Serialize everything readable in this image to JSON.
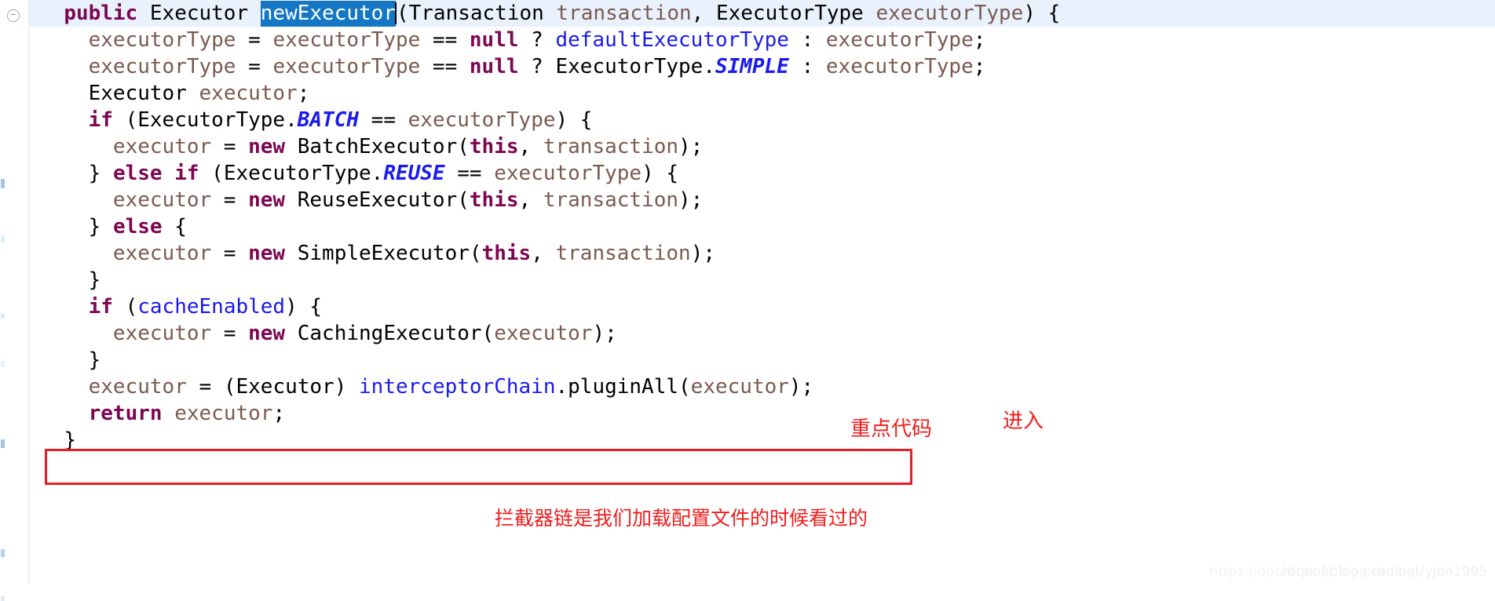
{
  "editor": {
    "language": "java",
    "colors": {
      "keyword": "#7d0552",
      "variable": "#7a5a52",
      "field": "#1a1aee",
      "enum_constant": "#1a1aee",
      "plain": "#000000",
      "selection_background": "#1577c4",
      "selection_foreground": "#ffffff",
      "current_line_background": "#e9f1fd",
      "annotation_red": "#ee1c22"
    },
    "gutter": {
      "fold_icon": "fold-collapse-icon"
    },
    "selection": {
      "text": "newExecutor",
      "line": 1
    },
    "lines": [
      {
        "indent": "  ",
        "highlighted": true,
        "tokens": [
          {
            "t": "public",
            "c": "kw"
          },
          {
            "t": " ",
            "c": "plain"
          },
          {
            "t": "Executor",
            "c": "plain"
          },
          {
            "t": " ",
            "c": "plain"
          },
          {
            "t": "newExecutor",
            "c": "sel"
          },
          {
            "t": "(",
            "c": "plain"
          },
          {
            "t": "Transaction",
            "c": "plain"
          },
          {
            "t": " ",
            "c": "plain"
          },
          {
            "t": "transaction",
            "c": "var"
          },
          {
            "t": ", ",
            "c": "plain"
          },
          {
            "t": "ExecutorType",
            "c": "plain"
          },
          {
            "t": " ",
            "c": "plain"
          },
          {
            "t": "executorType",
            "c": "var"
          },
          {
            "t": ") {",
            "c": "plain"
          }
        ]
      },
      {
        "indent": "    ",
        "highlighted": false,
        "tokens": [
          {
            "t": "executorType",
            "c": "var"
          },
          {
            "t": " = ",
            "c": "plain"
          },
          {
            "t": "executorType",
            "c": "var"
          },
          {
            "t": " == ",
            "c": "plain"
          },
          {
            "t": "null",
            "c": "kw"
          },
          {
            "t": " ? ",
            "c": "plain"
          },
          {
            "t": "defaultExecutorType",
            "c": "fld"
          },
          {
            "t": " : ",
            "c": "plain"
          },
          {
            "t": "executorType",
            "c": "var"
          },
          {
            "t": ";",
            "c": "plain"
          }
        ]
      },
      {
        "indent": "    ",
        "highlighted": false,
        "tokens": [
          {
            "t": "executorType",
            "c": "var"
          },
          {
            "t": " = ",
            "c": "plain"
          },
          {
            "t": "executorType",
            "c": "var"
          },
          {
            "t": " == ",
            "c": "plain"
          },
          {
            "t": "null",
            "c": "kw"
          },
          {
            "t": " ? ",
            "c": "plain"
          },
          {
            "t": "ExecutorType.",
            "c": "plain"
          },
          {
            "t": "SIMPLE",
            "c": "enumc"
          },
          {
            "t": " : ",
            "c": "plain"
          },
          {
            "t": "executorType",
            "c": "var"
          },
          {
            "t": ";",
            "c": "plain"
          }
        ]
      },
      {
        "indent": "    ",
        "highlighted": false,
        "tokens": [
          {
            "t": "Executor",
            "c": "plain"
          },
          {
            "t": " ",
            "c": "plain"
          },
          {
            "t": "executor",
            "c": "var"
          },
          {
            "t": ";",
            "c": "plain"
          }
        ]
      },
      {
        "indent": "    ",
        "highlighted": false,
        "tokens": [
          {
            "t": "if",
            "c": "kw"
          },
          {
            "t": " (",
            "c": "plain"
          },
          {
            "t": "ExecutorType.",
            "c": "plain"
          },
          {
            "t": "BATCH",
            "c": "enumc"
          },
          {
            "t": " == ",
            "c": "plain"
          },
          {
            "t": "executorType",
            "c": "var"
          },
          {
            "t": ") {",
            "c": "plain"
          }
        ]
      },
      {
        "indent": "      ",
        "highlighted": false,
        "tokens": [
          {
            "t": "executor",
            "c": "var"
          },
          {
            "t": " = ",
            "c": "plain"
          },
          {
            "t": "new",
            "c": "kw"
          },
          {
            "t": " ",
            "c": "plain"
          },
          {
            "t": "BatchExecutor(",
            "c": "plain"
          },
          {
            "t": "this",
            "c": "kw"
          },
          {
            "t": ", ",
            "c": "plain"
          },
          {
            "t": "transaction",
            "c": "var"
          },
          {
            "t": ");",
            "c": "plain"
          }
        ]
      },
      {
        "indent": "    ",
        "highlighted": false,
        "tokens": [
          {
            "t": "} ",
            "c": "plain"
          },
          {
            "t": "else",
            "c": "kw"
          },
          {
            "t": " ",
            "c": "plain"
          },
          {
            "t": "if",
            "c": "kw"
          },
          {
            "t": " (",
            "c": "plain"
          },
          {
            "t": "ExecutorType.",
            "c": "plain"
          },
          {
            "t": "REUSE",
            "c": "enumc"
          },
          {
            "t": " == ",
            "c": "plain"
          },
          {
            "t": "executorType",
            "c": "var"
          },
          {
            "t": ") {",
            "c": "plain"
          }
        ]
      },
      {
        "indent": "      ",
        "highlighted": false,
        "tokens": [
          {
            "t": "executor",
            "c": "var"
          },
          {
            "t": " = ",
            "c": "plain"
          },
          {
            "t": "new",
            "c": "kw"
          },
          {
            "t": " ",
            "c": "plain"
          },
          {
            "t": "ReuseExecutor(",
            "c": "plain"
          },
          {
            "t": "this",
            "c": "kw"
          },
          {
            "t": ", ",
            "c": "plain"
          },
          {
            "t": "transaction",
            "c": "var"
          },
          {
            "t": ");",
            "c": "plain"
          }
        ]
      },
      {
        "indent": "    ",
        "highlighted": false,
        "tokens": [
          {
            "t": "} ",
            "c": "plain"
          },
          {
            "t": "else",
            "c": "kw"
          },
          {
            "t": " {",
            "c": "plain"
          }
        ]
      },
      {
        "indent": "      ",
        "highlighted": false,
        "tokens": [
          {
            "t": "executor",
            "c": "var"
          },
          {
            "t": " = ",
            "c": "plain"
          },
          {
            "t": "new",
            "c": "kw"
          },
          {
            "t": " ",
            "c": "plain"
          },
          {
            "t": "SimpleExecutor(",
            "c": "plain"
          },
          {
            "t": "this",
            "c": "kw"
          },
          {
            "t": ", ",
            "c": "plain"
          },
          {
            "t": "transaction",
            "c": "var"
          },
          {
            "t": ");",
            "c": "plain"
          }
        ]
      },
      {
        "indent": "    ",
        "highlighted": false,
        "tokens": [
          {
            "t": "}",
            "c": "plain"
          }
        ]
      },
      {
        "indent": "    ",
        "highlighted": false,
        "tokens": [
          {
            "t": "if",
            "c": "kw"
          },
          {
            "t": " (",
            "c": "plain"
          },
          {
            "t": "cacheEnabled",
            "c": "fld"
          },
          {
            "t": ") {",
            "c": "plain"
          }
        ]
      },
      {
        "indent": "      ",
        "highlighted": false,
        "tokens": [
          {
            "t": "executor",
            "c": "var"
          },
          {
            "t": " = ",
            "c": "plain"
          },
          {
            "t": "new",
            "c": "kw"
          },
          {
            "t": " ",
            "c": "plain"
          },
          {
            "t": "CachingExecutor(",
            "c": "plain"
          },
          {
            "t": "executor",
            "c": "var"
          },
          {
            "t": ");",
            "c": "plain"
          }
        ]
      },
      {
        "indent": "    ",
        "highlighted": false,
        "tokens": [
          {
            "t": "}",
            "c": "plain"
          }
        ]
      },
      {
        "indent": "    ",
        "highlighted": false,
        "boxed": true,
        "tokens": [
          {
            "t": "executor",
            "c": "var"
          },
          {
            "t": " = (",
            "c": "plain"
          },
          {
            "t": "Executor",
            "c": "plain"
          },
          {
            "t": ") ",
            "c": "plain"
          },
          {
            "t": "interceptorChain",
            "c": "fld"
          },
          {
            "t": ".pluginAll(",
            "c": "plain"
          },
          {
            "t": "executor",
            "c": "var"
          },
          {
            "t": ");",
            "c": "plain"
          }
        ]
      },
      {
        "indent": "    ",
        "highlighted": false,
        "tokens": [
          {
            "t": "return",
            "c": "kw"
          },
          {
            "t": " ",
            "c": "plain"
          },
          {
            "t": "executor",
            "c": "var"
          },
          {
            "t": ";",
            "c": "plain"
          }
        ]
      },
      {
        "indent": "  ",
        "highlighted": false,
        "tokens": [
          {
            "t": "}",
            "c": "plain"
          }
        ]
      }
    ]
  },
  "annotations": {
    "key_code": "重点代码",
    "enter": "进入",
    "description": "拦截器链是我们加载配置文件的时候看过的"
  },
  "watermark": {
    "line1": "https://dpb-bobokr/blog.csdlogt/yjdn1995",
    "line2": "https://blog.csdn.net/yjdn1995"
  }
}
